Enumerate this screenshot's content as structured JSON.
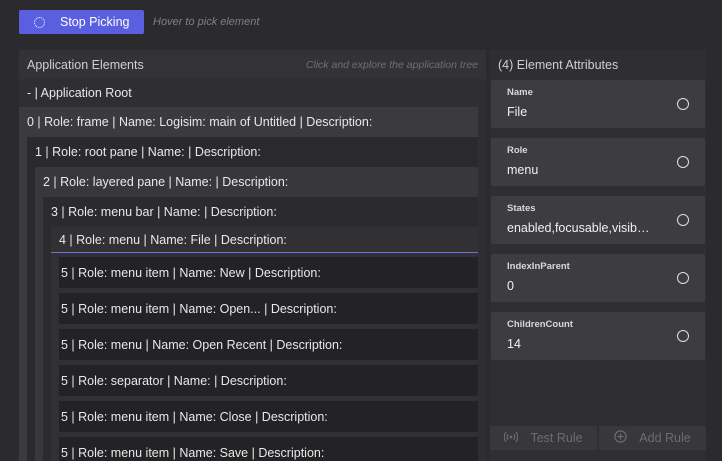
{
  "toolbar": {
    "stop_label": "Stop Picking",
    "hover_hint": "Hover to pick element"
  },
  "left_panel": {
    "title": "Application Elements",
    "hint": "Click and explore the application tree",
    "root_label": "- | Application Root",
    "nodes": [
      "0 | Role: frame | Name: Logisim: main of Untitled | Description:",
      "1 | Role: root pane | Name: | Description:",
      "2 | Role: layered pane | Name: | Description:",
      "3 | Role: menu bar | Name: | Description:",
      "4 | Role: menu | Name: File | Description:"
    ],
    "items": [
      "5 | Role: menu item | Name: New | Description:",
      "5 | Role: menu item | Name: Open... | Description:",
      "5 | Role: menu | Name: Open Recent | Description:",
      "5 | Role: separator | Name: | Description:",
      "5 | Role: menu item | Name: Close | Description:",
      "5 | Role: menu item | Name: Save | Description:"
    ]
  },
  "right_panel": {
    "title": "(4) Element Attributes",
    "attributes": [
      {
        "name": "Name",
        "value": "File"
      },
      {
        "name": "Role",
        "value": "menu"
      },
      {
        "name": "States",
        "value": "enabled,focusable,visible,showing"
      },
      {
        "name": "IndexInParent",
        "value": "0"
      },
      {
        "name": "ChildrenCount",
        "value": "14"
      }
    ],
    "test_rule_label": "Test Rule",
    "add_rule_label": "Add Rule"
  },
  "icons": {
    "spinner": "spinner-icon",
    "test_rule": "broadcast-icon",
    "add_rule": "plus-circle-icon"
  },
  "colors": {
    "accent": "#5a5fe0",
    "selection_underline": "#6b70e8",
    "background": "#2b2b2d"
  }
}
